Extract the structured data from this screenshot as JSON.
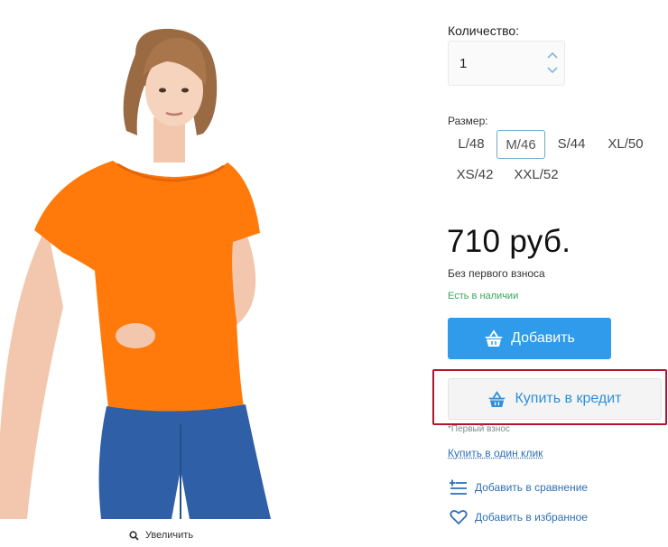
{
  "product_image": {
    "zoom_label": "Увеличить"
  },
  "quantity": {
    "label": "Количество:",
    "value": "1"
  },
  "size": {
    "label": "Размер:",
    "options": [
      "L/48",
      "M/46",
      "S/44",
      "XL/50",
      "XS/42",
      "XXL/52"
    ],
    "selected": "M/46"
  },
  "price": {
    "amount": "710 руб.",
    "note": "Без первого взноса",
    "stock": "Есть в наличии"
  },
  "buttons": {
    "add": "Добавить",
    "credit": "Купить в кредит",
    "first_payment_note": "*Первый взнос",
    "one_click": "Купить в один клик"
  },
  "links": {
    "compare": "Добавить в сравнение",
    "favorite": "Добавить в избранное"
  },
  "colors": {
    "accent": "#2f9bea",
    "stock_green": "#3aa75a",
    "highlight_red": "#b0172f",
    "tshirt": "#ff7a0a"
  }
}
